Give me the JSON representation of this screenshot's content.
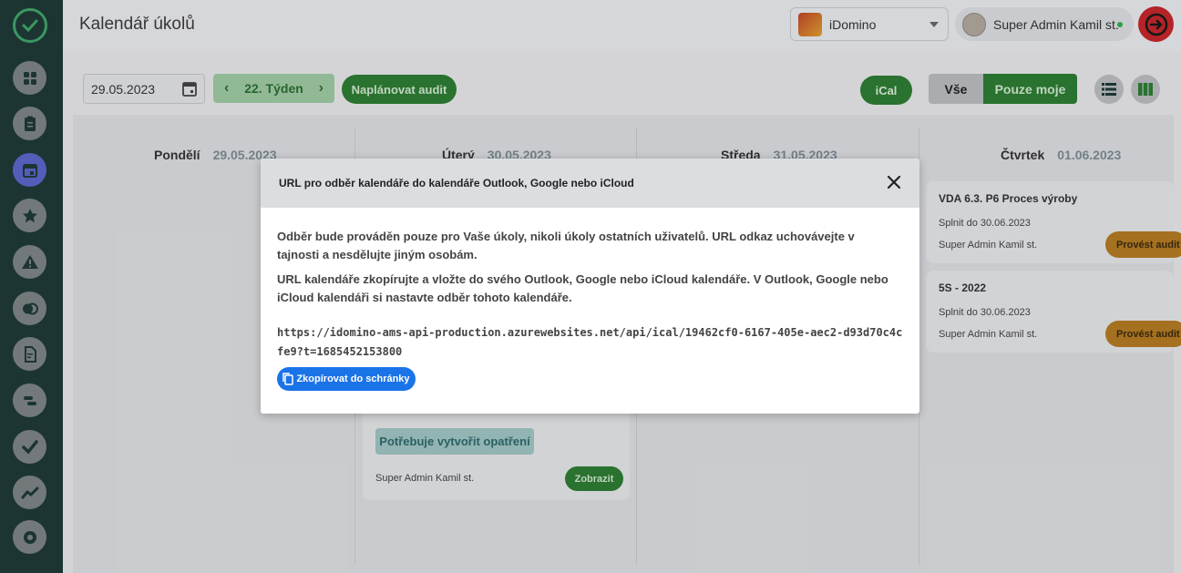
{
  "header": {
    "title": "Kalendář úkolů",
    "organization": "iDomino",
    "user_name": "Super Admin Kamil st."
  },
  "toolbar": {
    "date": "29.05.2023",
    "week_label": "22. Týden",
    "plan_audit_label": "Naplánovat audit",
    "ical_label": "iCal",
    "filter_all_label": "Vše",
    "filter_mine_label": "Pouze moje"
  },
  "days": [
    {
      "name": "Pondělí",
      "date": "29.05.2023"
    },
    {
      "name": "Úterý",
      "date": "30.05.2023"
    },
    {
      "name": "Středa",
      "date": "31.05.2023"
    },
    {
      "name": "Čtvrtek",
      "date": "01.06.2023"
    }
  ],
  "cards": [
    {
      "title": "VDA 6.3. P6 Proces výroby",
      "deadline": "Splnit do 30.06.2023",
      "user": "Super Admin Kamil st.",
      "action": "Provést audit"
    },
    {
      "title": "5S - 2022",
      "deadline": "Splnit do 30.06.2023",
      "user": "Super Admin Kamil st.",
      "action": "Provést audit"
    }
  ],
  "tuesday_card": {
    "status": "Potřebuje vytvořit opatření",
    "user": "Super Admin Kamil st.",
    "action": "Zobrazit"
  },
  "modal": {
    "title": "URL pro odběr kalendáře do kalendáře Outlook, Google nebo iCloud",
    "paragraph1": "Odběr bude prováděn pouze pro Vaše úkoly, nikoli úkoly ostatních uživatelů. URL odkaz uchovávejte v tajnosti a nesdělujte jiným osobám.",
    "paragraph2": "URL kalendáře zkopírujte a vložte do svého Outlook, Google nebo iCloud kalendáře. V Outlook, Google nebo iCloud kalendáři si nastavte odběr tohoto kalendáře.",
    "url": "https://idomino-ams-api-production.azurewebsites.net/api/ical/19462cf0-6167-405e-aec2-d93d70c4cfe9?t=1685452153800",
    "copy_label": "Zkopírovat do schránky"
  },
  "colors": {
    "sidebar": "#1f3a37",
    "primary_green": "#2d7c33",
    "copy_blue": "#1b73e8",
    "logout_red": "#c4262b",
    "audit_orange": "#b47a23"
  }
}
